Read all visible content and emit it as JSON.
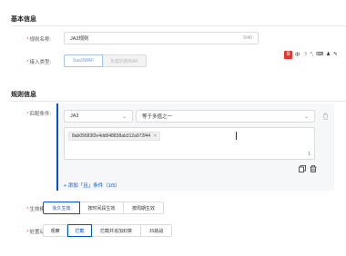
{
  "basic_section": {
    "title": "基本信息"
  },
  "rule_name": {
    "label": "规则名称:",
    "value": "JA3规则",
    "counter": "5/40"
  },
  "access_type": {
    "label": "接入类型:",
    "options": [
      "SaaSWAF",
      "负载均衡WAF"
    ]
  },
  "rule_section": {
    "title": "规则信息"
  },
  "match_condition": {
    "label": "匹配条件:",
    "field": "JA3",
    "operator": "等于多值之一",
    "tag_value": "8ab05683f2e4dd948838ab312a972f44",
    "tag_count": "1",
    "add_link": "+ 添加「且」条件（1/5）"
  },
  "effective_mode": {
    "label": "生效模式:",
    "options": [
      "永久生效",
      "按时间段生效",
      "按周期生效"
    ]
  },
  "action": {
    "label": "处置动作:",
    "options": [
      "观察",
      "拦截",
      "拦截并追加封禁",
      "JS挑战"
    ]
  },
  "ime_toolbar": {
    "logo": "S",
    "items": [
      "中",
      "☽",
      "°,",
      "⌨",
      "♟",
      "✎"
    ]
  },
  "colors": {
    "primary": "#0052d9",
    "required": "#e34d59"
  }
}
